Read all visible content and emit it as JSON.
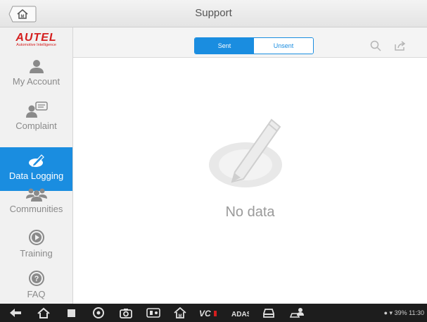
{
  "header": {
    "title": "Support"
  },
  "brand": {
    "name": "AUTEL",
    "tagline": "Automotive Intelligence"
  },
  "sidebar": {
    "items": [
      {
        "label": "My Account",
        "icon": "account-icon"
      },
      {
        "label": "Complaint",
        "icon": "complaint-icon"
      },
      {
        "label": "Data Logging",
        "icon": "data-logging-icon",
        "active": true
      },
      {
        "label": "Communities",
        "icon": "communities-icon"
      },
      {
        "label": "Training",
        "icon": "training-icon"
      },
      {
        "label": "FAQ",
        "icon": "faq-icon"
      }
    ]
  },
  "tabs": {
    "sent": "Sent",
    "unsent": "Unsent"
  },
  "main": {
    "empty_text": "No data"
  },
  "statusbar": {
    "battery": "39%",
    "time": "11:30"
  },
  "colors": {
    "accent": "#1a8de0",
    "brand_red": "#d41e1e",
    "nav_bar": "#1d1d1d"
  }
}
